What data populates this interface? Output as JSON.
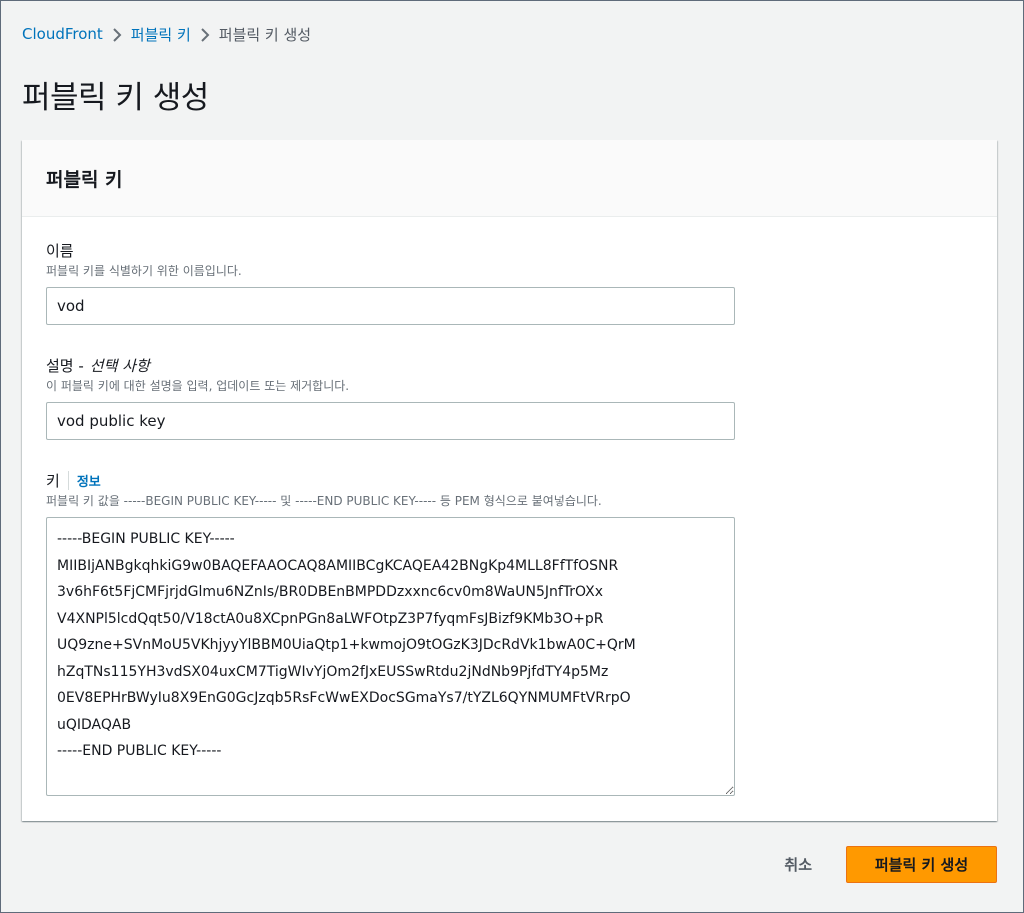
{
  "breadcrumb": {
    "items": [
      {
        "label": "CloudFront"
      },
      {
        "label": "퍼블릭 키"
      },
      {
        "label": "퍼블릭 키 생성"
      }
    ]
  },
  "page": {
    "title": "퍼블릭 키 생성"
  },
  "panel": {
    "title": "퍼블릭 키",
    "name_field": {
      "label": "이름",
      "description": "퍼블릭 키를 식별하기 위한 이름입니다.",
      "value": "vod"
    },
    "desc_field": {
      "label": "설명 -",
      "optional": "선택 사항",
      "description": "이 퍼블릭 키에 대한 설명을 입력, 업데이트 또는 제거합니다.",
      "value": "vod public key"
    },
    "key_field": {
      "label": "키",
      "info_link": "정보",
      "description": "퍼블릭 키 값을 -----BEGIN PUBLIC KEY----- 및 -----END PUBLIC KEY----- 등 PEM 형식으로 붙여넣습니다.",
      "value": "-----BEGIN PUBLIC KEY-----\nMIIBIjANBgkqhkiG9w0BAQEFAAOCAQ8AMIIBCgKCAQEA42BNgKp4MLL8FfTfOSNR\n3v6hF6t5FjCMFjrjdGlmu6NZnIs/BR0DBEnBMPDDzxxnc6cv0m8WaUN5JnfTrOXx\nV4XNPl5lcdQqt50/V18ctA0u8XCpnPGn8aLWFOtpZ3P7fyqmFsJBizf9KMb3O+pR\nUQ9zne+SVnMoU5VKhjyyYlBBM0UiaQtp1+kwmojO9tOGzK3JDcRdVk1bwA0C+QrM\nhZqTNs115YH3vdSX04uxCM7TigWIvYjOm2fJxEUSSwRtdu2jNdNb9PjfdTY4p5Mz\n0EV8EPHrBWyIu8X9EnG0GcJzqb5RsFcWwEXDocSGmaYs7/tYZL6QYNMUMFtVRrpO\nuQIDAQAB\n-----END PUBLIC KEY-----"
    }
  },
  "actions": {
    "cancel_label": "취소",
    "submit_label": "퍼블릭 키 생성"
  }
}
